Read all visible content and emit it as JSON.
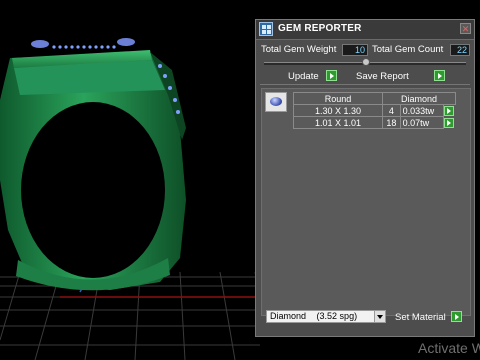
{
  "panel": {
    "title": "GEM REPORTER",
    "close_glyph": "✕",
    "total_gem_weight_label": "Total Gem Weight",
    "total_gem_weight_value": "10",
    "total_gem_count_label": "Total Gem Count",
    "total_gem_count_value": "22",
    "update_label": "Update",
    "save_report_label": "Save Report",
    "table": {
      "shape_header": "Round",
      "material_header": "Diamond",
      "rows": [
        {
          "size": "1.30 X 1.30",
          "count": "4",
          "weight": "0.033tw"
        },
        {
          "size": "1.01 X 1.01",
          "count": "18",
          "weight": "0.07tw"
        }
      ]
    },
    "material_select": {
      "value": "Diamond",
      "density": "(3.52 spg)"
    },
    "set_material_label": "Set Material"
  },
  "watermark": "Activate W",
  "colors": {
    "ring_green": "#1f8a4a",
    "panel_bg": "#4d4d4d",
    "action_green": "#2f9a2f",
    "value_text": "#7fd6ff",
    "grid_red": "#8a1010"
  },
  "icons": [
    "gem-reporter-app-icon",
    "close-icon",
    "gem-thumbnail-icon",
    "arrow-right-icon",
    "chevron-down-icon"
  ]
}
